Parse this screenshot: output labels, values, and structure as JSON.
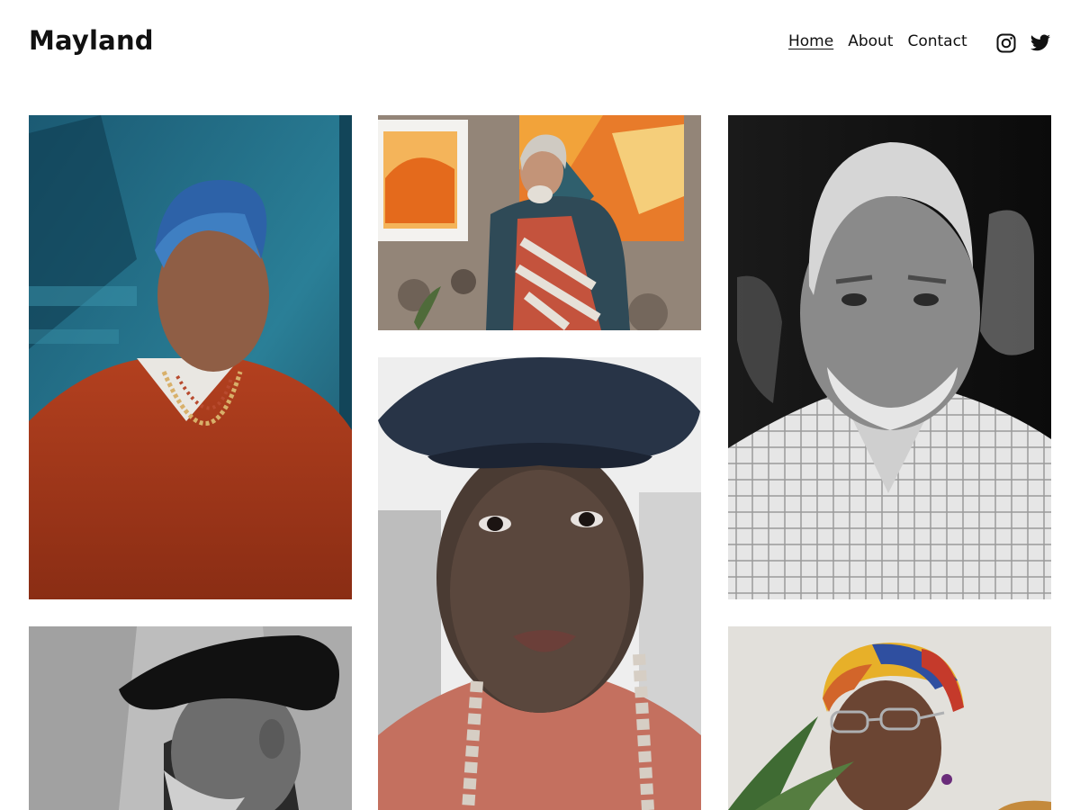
{
  "site": {
    "title": "Mayland"
  },
  "nav": {
    "items": [
      {
        "label": "Home",
        "active": true
      },
      {
        "label": "About",
        "active": false
      },
      {
        "label": "Contact",
        "active": false
      }
    ]
  },
  "social": [
    {
      "icon": "instagram-icon"
    },
    {
      "icon": "twitter-icon"
    }
  ],
  "gallery": {
    "photos": [
      {
        "subject": "woman with blue headscarf and red sweater"
      },
      {
        "subject": "painter in apron in front of paintings"
      },
      {
        "subject": "older man with white beard, black and white"
      },
      {
        "subject": "young man in navy cap with chain necklace"
      },
      {
        "subject": "man in black cap, black and white"
      },
      {
        "subject": "woman with colorful headwrap and glasses"
      }
    ]
  },
  "colors": {
    "text": "#111111",
    "background": "#ffffff"
  }
}
